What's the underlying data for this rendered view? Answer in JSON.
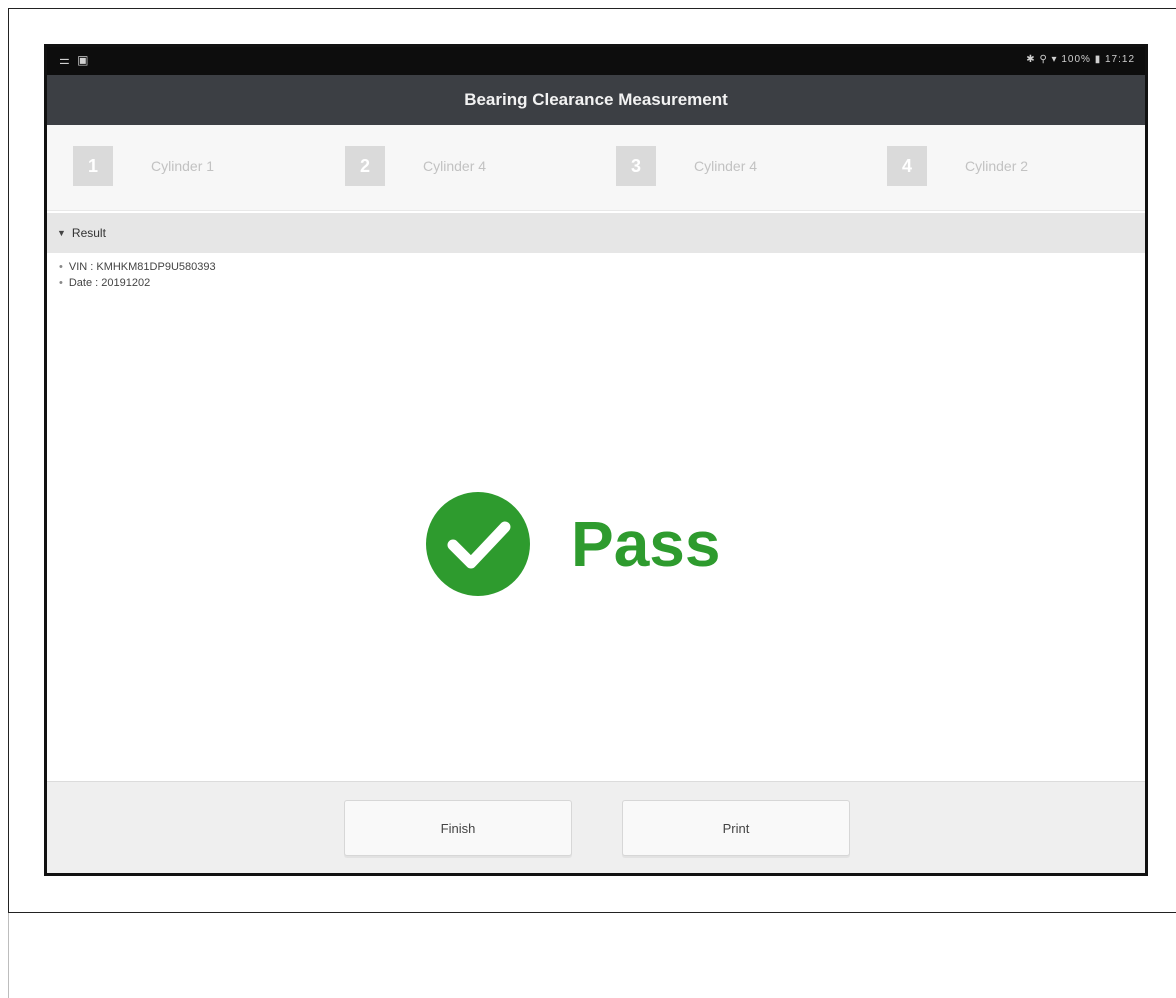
{
  "status_bar": {
    "left_icons": "⚌ ▣",
    "right_text": "✱ ⚲ ▾ 100% ▮ 17:12"
  },
  "app": {
    "title": "Bearing Clearance Measurement"
  },
  "steps": [
    {
      "number": "1",
      "label": "Cylinder 1"
    },
    {
      "number": "2",
      "label": "Cylinder 4"
    },
    {
      "number": "3",
      "label": "Cylinder 4"
    },
    {
      "number": "4",
      "label": "Cylinder 2"
    }
  ],
  "result": {
    "header": "Result",
    "vin": "VIN : KMHKM81DP9U580393",
    "date": "Date : 20191202",
    "status": "Pass",
    "status_color": "#2e9b2e"
  },
  "buttons": {
    "finish": "Finish",
    "print": "Print"
  },
  "icons": {
    "result_icon": "check-circle-icon"
  }
}
